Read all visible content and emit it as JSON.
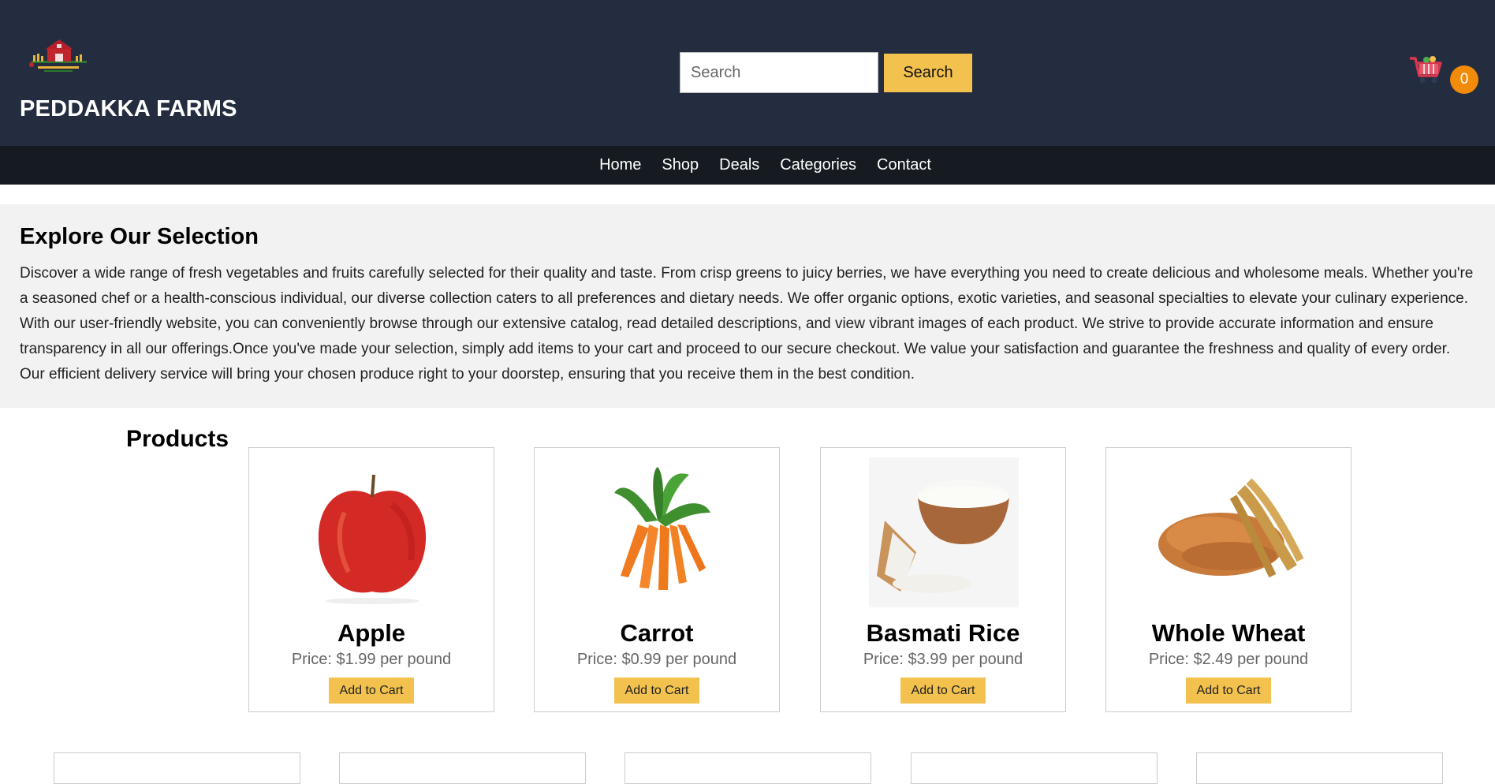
{
  "header": {
    "brand": "PEDDAKKA FARMS",
    "search_placeholder": "Search",
    "search_button": "Search",
    "cart_count": "0"
  },
  "nav": {
    "items": [
      "Home",
      "Shop",
      "Deals",
      "Categories",
      "Contact"
    ]
  },
  "intro": {
    "title": "Explore Our Selection",
    "body": "Discover a wide range of fresh vegetables and fruits carefully selected for their quality and taste. From crisp greens to juicy berries, we have everything you need to create delicious and wholesome meals. Whether you're a seasoned chef or a health-conscious individual, our diverse collection caters to all preferences and dietary needs. We offer organic options, exotic varieties, and seasonal specialties to elevate your culinary experience. With our user-friendly website, you can conveniently browse through our extensive catalog, read detailed descriptions, and view vibrant images of each product. We strive to provide accurate information and ensure transparency in all our offerings.Once you've made your selection, simply add items to your cart and proceed to our secure checkout. We value your satisfaction and guarantee the freshness and quality of every order. Our efficient delivery service will bring your chosen produce right to your doorstep, ensuring that you receive them in the best condition."
  },
  "products": {
    "title": "Products",
    "items": [
      {
        "name": "Apple",
        "price": "Price: $1.99 per pound",
        "button": "Add to Cart",
        "image": "apple-image"
      },
      {
        "name": "Carrot",
        "price": "Price: $0.99 per pound",
        "button": "Add to Cart",
        "image": "carrot-image"
      },
      {
        "name": "Basmati Rice",
        "price": "Price: $3.99 per pound",
        "button": "Add to Cart",
        "image": "rice-image"
      },
      {
        "name": "Whole Wheat",
        "price": "Price: $2.49 per pound",
        "button": "Add to Cart",
        "image": "wheat-image"
      }
    ]
  },
  "colors": {
    "header_bg": "#232d3f",
    "nav_bg": "#161b22",
    "accent": "#f2c14e",
    "badge": "#f28a0a"
  }
}
